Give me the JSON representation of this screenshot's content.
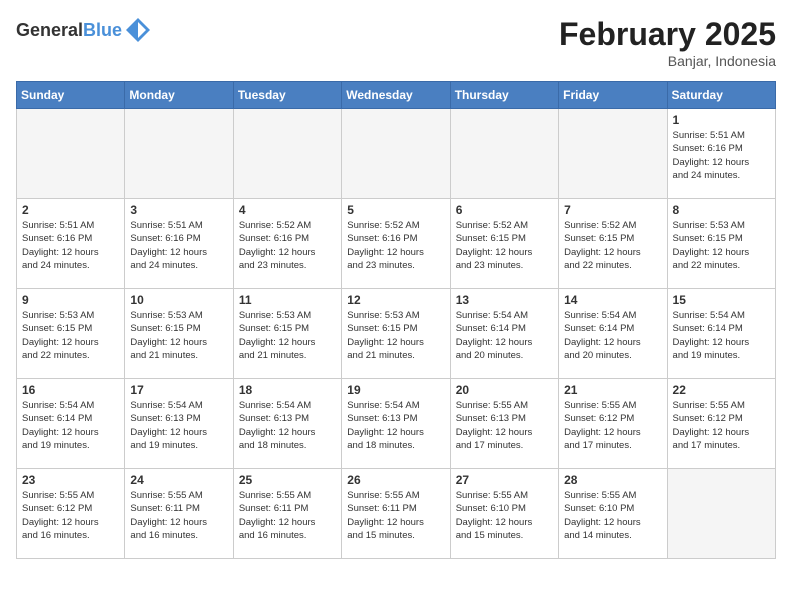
{
  "header": {
    "logo_general": "General",
    "logo_blue": "Blue",
    "month_title": "February 2025",
    "location": "Banjar, Indonesia"
  },
  "days_of_week": [
    "Sunday",
    "Monday",
    "Tuesday",
    "Wednesday",
    "Thursday",
    "Friday",
    "Saturday"
  ],
  "weeks": [
    [
      {
        "day": "",
        "empty": true
      },
      {
        "day": "",
        "empty": true
      },
      {
        "day": "",
        "empty": true
      },
      {
        "day": "",
        "empty": true
      },
      {
        "day": "",
        "empty": true
      },
      {
        "day": "",
        "empty": true
      },
      {
        "day": "1",
        "info": "Sunrise: 5:51 AM\nSunset: 6:16 PM\nDaylight: 12 hours\nand 24 minutes."
      }
    ],
    [
      {
        "day": "2",
        "info": "Sunrise: 5:51 AM\nSunset: 6:16 PM\nDaylight: 12 hours\nand 24 minutes."
      },
      {
        "day": "3",
        "info": "Sunrise: 5:51 AM\nSunset: 6:16 PM\nDaylight: 12 hours\nand 24 minutes."
      },
      {
        "day": "4",
        "info": "Sunrise: 5:52 AM\nSunset: 6:16 PM\nDaylight: 12 hours\nand 23 minutes."
      },
      {
        "day": "5",
        "info": "Sunrise: 5:52 AM\nSunset: 6:16 PM\nDaylight: 12 hours\nand 23 minutes."
      },
      {
        "day": "6",
        "info": "Sunrise: 5:52 AM\nSunset: 6:15 PM\nDaylight: 12 hours\nand 23 minutes."
      },
      {
        "day": "7",
        "info": "Sunrise: 5:52 AM\nSunset: 6:15 PM\nDaylight: 12 hours\nand 22 minutes."
      },
      {
        "day": "8",
        "info": "Sunrise: 5:53 AM\nSunset: 6:15 PM\nDaylight: 12 hours\nand 22 minutes."
      }
    ],
    [
      {
        "day": "9",
        "info": "Sunrise: 5:53 AM\nSunset: 6:15 PM\nDaylight: 12 hours\nand 22 minutes."
      },
      {
        "day": "10",
        "info": "Sunrise: 5:53 AM\nSunset: 6:15 PM\nDaylight: 12 hours\nand 21 minutes."
      },
      {
        "day": "11",
        "info": "Sunrise: 5:53 AM\nSunset: 6:15 PM\nDaylight: 12 hours\nand 21 minutes."
      },
      {
        "day": "12",
        "info": "Sunrise: 5:53 AM\nSunset: 6:15 PM\nDaylight: 12 hours\nand 21 minutes."
      },
      {
        "day": "13",
        "info": "Sunrise: 5:54 AM\nSunset: 6:14 PM\nDaylight: 12 hours\nand 20 minutes."
      },
      {
        "day": "14",
        "info": "Sunrise: 5:54 AM\nSunset: 6:14 PM\nDaylight: 12 hours\nand 20 minutes."
      },
      {
        "day": "15",
        "info": "Sunrise: 5:54 AM\nSunset: 6:14 PM\nDaylight: 12 hours\nand 19 minutes."
      }
    ],
    [
      {
        "day": "16",
        "info": "Sunrise: 5:54 AM\nSunset: 6:14 PM\nDaylight: 12 hours\nand 19 minutes."
      },
      {
        "day": "17",
        "info": "Sunrise: 5:54 AM\nSunset: 6:13 PM\nDaylight: 12 hours\nand 19 minutes."
      },
      {
        "day": "18",
        "info": "Sunrise: 5:54 AM\nSunset: 6:13 PM\nDaylight: 12 hours\nand 18 minutes."
      },
      {
        "day": "19",
        "info": "Sunrise: 5:54 AM\nSunset: 6:13 PM\nDaylight: 12 hours\nand 18 minutes."
      },
      {
        "day": "20",
        "info": "Sunrise: 5:55 AM\nSunset: 6:13 PM\nDaylight: 12 hours\nand 17 minutes."
      },
      {
        "day": "21",
        "info": "Sunrise: 5:55 AM\nSunset: 6:12 PM\nDaylight: 12 hours\nand 17 minutes."
      },
      {
        "day": "22",
        "info": "Sunrise: 5:55 AM\nSunset: 6:12 PM\nDaylight: 12 hours\nand 17 minutes."
      }
    ],
    [
      {
        "day": "23",
        "info": "Sunrise: 5:55 AM\nSunset: 6:12 PM\nDaylight: 12 hours\nand 16 minutes."
      },
      {
        "day": "24",
        "info": "Sunrise: 5:55 AM\nSunset: 6:11 PM\nDaylight: 12 hours\nand 16 minutes."
      },
      {
        "day": "25",
        "info": "Sunrise: 5:55 AM\nSunset: 6:11 PM\nDaylight: 12 hours\nand 16 minutes."
      },
      {
        "day": "26",
        "info": "Sunrise: 5:55 AM\nSunset: 6:11 PM\nDaylight: 12 hours\nand 15 minutes."
      },
      {
        "day": "27",
        "info": "Sunrise: 5:55 AM\nSunset: 6:10 PM\nDaylight: 12 hours\nand 15 minutes."
      },
      {
        "day": "28",
        "info": "Sunrise: 5:55 AM\nSunset: 6:10 PM\nDaylight: 12 hours\nand 14 minutes."
      },
      {
        "day": "",
        "empty": true
      }
    ]
  ]
}
